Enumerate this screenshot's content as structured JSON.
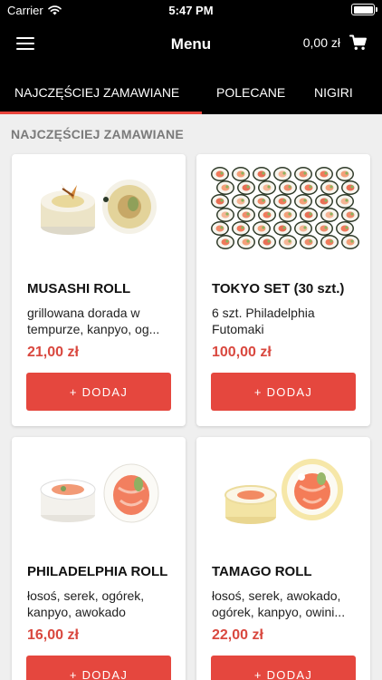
{
  "status_bar": {
    "carrier": "Carrier",
    "time": "5:47 PM"
  },
  "nav": {
    "title": "Menu",
    "cart_total": "0,00 zł"
  },
  "tabs": [
    {
      "label": "NAJCZĘŚCIEJ ZAMAWIANE",
      "active": true
    },
    {
      "label": "POLECANE",
      "active": false
    },
    {
      "label": "NIGIRI",
      "active": false
    }
  ],
  "section": {
    "title": "NAJCZĘŚCIEJ ZAMAWIANE"
  },
  "products": [
    {
      "name": "MUSASHI ROLL",
      "description": "grillowana dorada w tempurze, kanpyo, og...",
      "price": "21,00 zł",
      "button": "+ DODAJ"
    },
    {
      "name": "TOKYO SET (30 szt.)",
      "description": "6 szt. Philadelphia Futomaki",
      "price": "100,00 zł",
      "button": "+ DODAJ"
    },
    {
      "name": "PHILADELPHIA ROLL",
      "description": "łosoś, serek, ogórek, kanpyo, awokado",
      "price": "16,00 zł",
      "button": "+ DODAJ"
    },
    {
      "name": "TAMAGO ROLL",
      "description": "łosoś, serek, awokado, ogórek, kanpyo, owini...",
      "price": "22,00 zł",
      "button": "+ DODAJ"
    }
  ],
  "colors": {
    "accent": "#e5473e",
    "header_bg": "#000000",
    "page_bg": "#efefef",
    "price": "#d9483f"
  },
  "icons": [
    "wifi-icon",
    "battery-icon",
    "hamburger-menu-icon",
    "shopping-cart-icon"
  ]
}
